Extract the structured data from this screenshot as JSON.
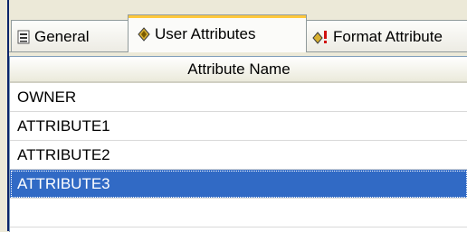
{
  "tabs": [
    {
      "label": "General",
      "icon": "list-icon"
    },
    {
      "label": "User Attributes",
      "icon": "diamond-icon"
    },
    {
      "label": "Format Attribute",
      "icon": "diamond-exclamation-icon"
    }
  ],
  "active_tab": "User Attributes",
  "grid": {
    "header": "Attribute Name",
    "rows": [
      "OWNER",
      "ATTRIBUTE1",
      "ATTRIBUTE2",
      "ATTRIBUTE3"
    ],
    "selected_row": "ATTRIBUTE3"
  },
  "colors": {
    "selection": "#316AC5",
    "active_tab_highlight": "#FFC83C",
    "window_edge": "#0A246A"
  }
}
